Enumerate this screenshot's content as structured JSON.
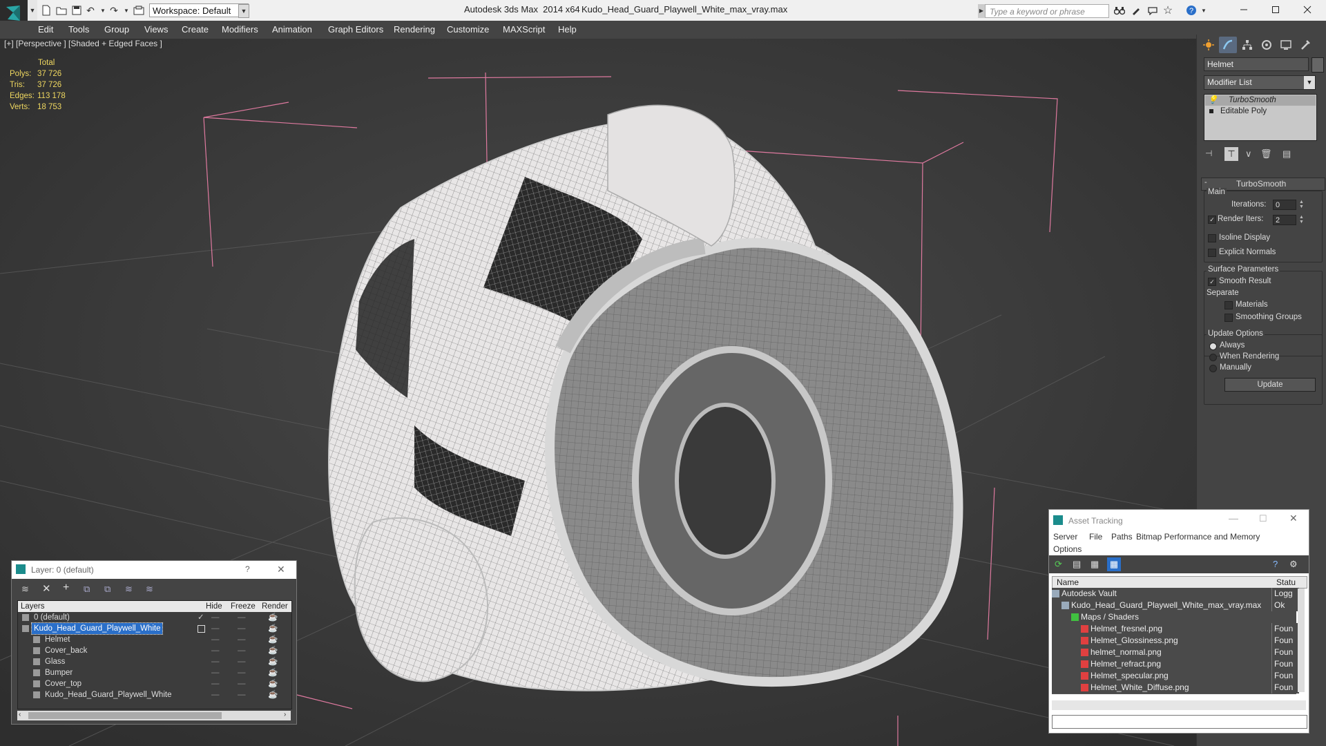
{
  "titlebar": {
    "workspace_label": "Workspace: Default",
    "app_title": "Autodesk 3ds Max  2014 x64",
    "file_title": "Kudo_Head_Guard_Playwell_White_max_vray.max",
    "search_placeholder": "Type a keyword or phrase"
  },
  "menu": [
    "Edit",
    "Tools",
    "Group",
    "Views",
    "Create",
    "Modifiers",
    "Animation",
    "Graph Editors",
    "Rendering",
    "Customize",
    "MAXScript",
    "Help"
  ],
  "viewport": {
    "label": "[+] [Perspective ] [Shaded + Edged Faces ]",
    "stats": {
      "header": "Total",
      "rows": [
        {
          "label": "Polys:",
          "value": "37 726"
        },
        {
          "label": "Tris:",
          "value": "37 726"
        },
        {
          "label": "Edges:",
          "value": "113 178"
        },
        {
          "label": "Verts:",
          "value": "18 753"
        }
      ]
    }
  },
  "command_panel": {
    "object_name": "Helmet",
    "modifier_list": "Modifier List",
    "stack": [
      "TurboSmooth",
      "Editable Poly"
    ],
    "rollout_title": "TurboSmooth",
    "main_group": "Main",
    "iterations_label": "Iterations:",
    "iterations_value": "0",
    "render_iters_label": "Render Iters:",
    "render_iters_value": "2",
    "isoline_label": "Isoline Display",
    "explicit_label": "Explicit Normals",
    "surface_group": "Surface Parameters",
    "smooth_result_label": "Smooth Result",
    "separate_label": "Separate",
    "materials_label": "Materials",
    "smoothing_groups_label": "Smoothing Groups",
    "update_group": "Update Options",
    "always_label": "Always",
    "when_rendering_label": "When Rendering",
    "manually_label": "Manually",
    "update_button": "Update"
  },
  "layer_window": {
    "title": "Layer: 0 (default)",
    "help": "?",
    "columns": {
      "layers": "Layers",
      "hide": "Hide",
      "freeze": "Freeze",
      "render": "Render"
    },
    "rows": [
      {
        "name": "0 (default)",
        "level": 1,
        "selected": false
      },
      {
        "name": "Kudo_Head_Guard_Playwell_White",
        "level": 1,
        "selected": true
      },
      {
        "name": "Helmet",
        "level": 2,
        "selected": false
      },
      {
        "name": "Cover_back",
        "level": 2,
        "selected": false
      },
      {
        "name": "Glass",
        "level": 2,
        "selected": false
      },
      {
        "name": "Bumper",
        "level": 2,
        "selected": false
      },
      {
        "name": "Cover_top",
        "level": 2,
        "selected": false
      },
      {
        "name": "Kudo_Head_Guard_Playwell_White",
        "level": 2,
        "selected": false
      }
    ]
  },
  "asset_tracking": {
    "title": "Asset Tracking",
    "menu": [
      "Server",
      "File",
      "Paths",
      "Bitmap Performance and Memory",
      "Options"
    ],
    "col_name": "Name",
    "col_status": "Statu",
    "rows": [
      {
        "name": "Autodesk Vault",
        "status": "Logg",
        "indent": 0
      },
      {
        "name": "Kudo_Head_Guard_Playwell_White_max_vray.max",
        "status": "Ok",
        "indent": 1
      },
      {
        "name": "Maps / Shaders",
        "status": "",
        "indent": 2
      },
      {
        "name": "Helmet_fresnel.png",
        "status": "Foun",
        "indent": 3
      },
      {
        "name": "Helmet_Glossiness.png",
        "status": "Foun",
        "indent": 3
      },
      {
        "name": "helmet_normal.png",
        "status": "Foun",
        "indent": 3
      },
      {
        "name": "Helmet_refract.png",
        "status": "Foun",
        "indent": 3
      },
      {
        "name": "Helmet_specular.png",
        "status": "Foun",
        "indent": 3
      },
      {
        "name": "Helmet_White_Diffuse.png",
        "status": "Foun",
        "indent": 3
      }
    ]
  }
}
